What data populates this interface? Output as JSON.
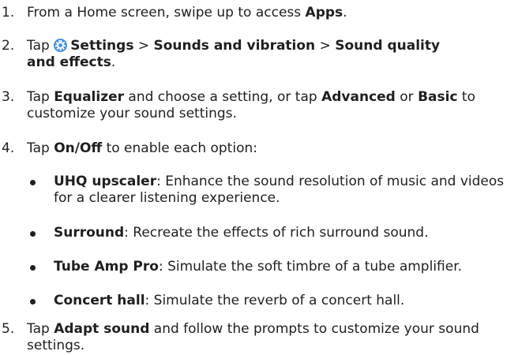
{
  "steps": [
    {
      "num": "1.",
      "t1": "From a Home screen, swipe up to access ",
      "b1": "Apps",
      "t2": "."
    },
    {
      "num": "2.",
      "t1": "Tap ",
      "icon": "settings-gear-icon",
      "b1": "Settings",
      "s1": " > ",
      "b2": "Sounds and vibration",
      "s2": " > ",
      "b3": "Sound quality and effects",
      "t2": "."
    },
    {
      "num": "3.",
      "t1": "Tap ",
      "b1": "Equalizer",
      "t2": " and choose a setting, or tap ",
      "b2": "Advanced",
      "t3": " or ",
      "b3": "Basic",
      "t4": " to customize your sound settings."
    },
    {
      "num": "4.",
      "t1": "Tap ",
      "b1": "On/Off",
      "t2": " to enable each option:",
      "options": [
        {
          "name": "UHQ upscaler",
          "desc": ": Enhance the sound resolution of music and videos for a clearer listening experience."
        },
        {
          "name": "Surround",
          "desc": ": Recreate the effects of rich surround sound."
        },
        {
          "name": "Tube Amp Pro",
          "desc": ": Simulate the soft timbre of a tube amplifier."
        },
        {
          "name": "Concert hall",
          "desc": ": Simulate the reverb of a concert hall."
        }
      ]
    },
    {
      "num": "5.",
      "t1": "Tap ",
      "b1": "Adapt sound",
      "t2": " and follow the prompts to customize your sound settings."
    }
  ],
  "colors": {
    "text": "#1f1f1f",
    "icon": "#4a8fe0"
  }
}
